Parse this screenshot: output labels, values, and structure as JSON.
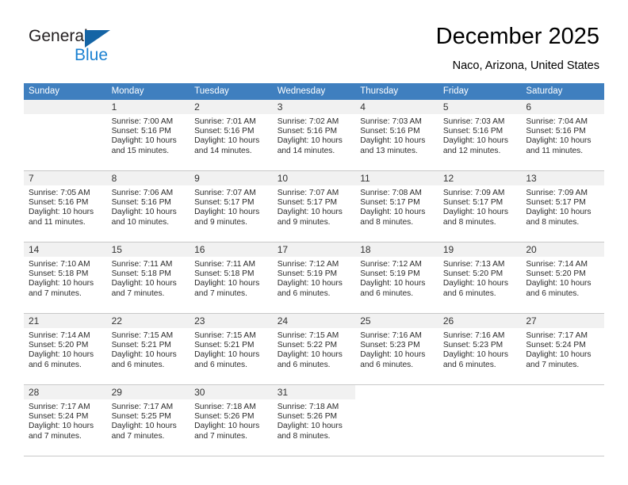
{
  "brand": {
    "name_part1": "General",
    "name_part2": "Blue",
    "triangle_color": "#1464a5",
    "blue_text_color": "#1b81d1"
  },
  "header": {
    "title": "December 2025",
    "subtitle": "Naco, Arizona, United States"
  },
  "theme": {
    "header_row_bg": "#3f7fbf",
    "header_row_text": "#ffffff",
    "daynumber_bg": "#f1f1f1",
    "grid_line": "#c8c8c8"
  },
  "weekdays": [
    "Sunday",
    "Monday",
    "Tuesday",
    "Wednesday",
    "Thursday",
    "Friday",
    "Saturday"
  ],
  "weeks": [
    [
      {
        "day": "",
        "sunrise": "",
        "sunset": "",
        "daylight_line1": "",
        "daylight_line2": ""
      },
      {
        "day": "1",
        "sunrise": "Sunrise: 7:00 AM",
        "sunset": "Sunset: 5:16 PM",
        "daylight_line1": "Daylight: 10 hours",
        "daylight_line2": "and 15 minutes."
      },
      {
        "day": "2",
        "sunrise": "Sunrise: 7:01 AM",
        "sunset": "Sunset: 5:16 PM",
        "daylight_line1": "Daylight: 10 hours",
        "daylight_line2": "and 14 minutes."
      },
      {
        "day": "3",
        "sunrise": "Sunrise: 7:02 AM",
        "sunset": "Sunset: 5:16 PM",
        "daylight_line1": "Daylight: 10 hours",
        "daylight_line2": "and 14 minutes."
      },
      {
        "day": "4",
        "sunrise": "Sunrise: 7:03 AM",
        "sunset": "Sunset: 5:16 PM",
        "daylight_line1": "Daylight: 10 hours",
        "daylight_line2": "and 13 minutes."
      },
      {
        "day": "5",
        "sunrise": "Sunrise: 7:03 AM",
        "sunset": "Sunset: 5:16 PM",
        "daylight_line1": "Daylight: 10 hours",
        "daylight_line2": "and 12 minutes."
      },
      {
        "day": "6",
        "sunrise": "Sunrise: 7:04 AM",
        "sunset": "Sunset: 5:16 PM",
        "daylight_line1": "Daylight: 10 hours",
        "daylight_line2": "and 11 minutes."
      }
    ],
    [
      {
        "day": "7",
        "sunrise": "Sunrise: 7:05 AM",
        "sunset": "Sunset: 5:16 PM",
        "daylight_line1": "Daylight: 10 hours",
        "daylight_line2": "and 11 minutes."
      },
      {
        "day": "8",
        "sunrise": "Sunrise: 7:06 AM",
        "sunset": "Sunset: 5:16 PM",
        "daylight_line1": "Daylight: 10 hours",
        "daylight_line2": "and 10 minutes."
      },
      {
        "day": "9",
        "sunrise": "Sunrise: 7:07 AM",
        "sunset": "Sunset: 5:17 PM",
        "daylight_line1": "Daylight: 10 hours",
        "daylight_line2": "and 9 minutes."
      },
      {
        "day": "10",
        "sunrise": "Sunrise: 7:07 AM",
        "sunset": "Sunset: 5:17 PM",
        "daylight_line1": "Daylight: 10 hours",
        "daylight_line2": "and 9 minutes."
      },
      {
        "day": "11",
        "sunrise": "Sunrise: 7:08 AM",
        "sunset": "Sunset: 5:17 PM",
        "daylight_line1": "Daylight: 10 hours",
        "daylight_line2": "and 8 minutes."
      },
      {
        "day": "12",
        "sunrise": "Sunrise: 7:09 AM",
        "sunset": "Sunset: 5:17 PM",
        "daylight_line1": "Daylight: 10 hours",
        "daylight_line2": "and 8 minutes."
      },
      {
        "day": "13",
        "sunrise": "Sunrise: 7:09 AM",
        "sunset": "Sunset: 5:17 PM",
        "daylight_line1": "Daylight: 10 hours",
        "daylight_line2": "and 8 minutes."
      }
    ],
    [
      {
        "day": "14",
        "sunrise": "Sunrise: 7:10 AM",
        "sunset": "Sunset: 5:18 PM",
        "daylight_line1": "Daylight: 10 hours",
        "daylight_line2": "and 7 minutes."
      },
      {
        "day": "15",
        "sunrise": "Sunrise: 7:11 AM",
        "sunset": "Sunset: 5:18 PM",
        "daylight_line1": "Daylight: 10 hours",
        "daylight_line2": "and 7 minutes."
      },
      {
        "day": "16",
        "sunrise": "Sunrise: 7:11 AM",
        "sunset": "Sunset: 5:18 PM",
        "daylight_line1": "Daylight: 10 hours",
        "daylight_line2": "and 7 minutes."
      },
      {
        "day": "17",
        "sunrise": "Sunrise: 7:12 AM",
        "sunset": "Sunset: 5:19 PM",
        "daylight_line1": "Daylight: 10 hours",
        "daylight_line2": "and 6 minutes."
      },
      {
        "day": "18",
        "sunrise": "Sunrise: 7:12 AM",
        "sunset": "Sunset: 5:19 PM",
        "daylight_line1": "Daylight: 10 hours",
        "daylight_line2": "and 6 minutes."
      },
      {
        "day": "19",
        "sunrise": "Sunrise: 7:13 AM",
        "sunset": "Sunset: 5:20 PM",
        "daylight_line1": "Daylight: 10 hours",
        "daylight_line2": "and 6 minutes."
      },
      {
        "day": "20",
        "sunrise": "Sunrise: 7:14 AM",
        "sunset": "Sunset: 5:20 PM",
        "daylight_line1": "Daylight: 10 hours",
        "daylight_line2": "and 6 minutes."
      }
    ],
    [
      {
        "day": "21",
        "sunrise": "Sunrise: 7:14 AM",
        "sunset": "Sunset: 5:20 PM",
        "daylight_line1": "Daylight: 10 hours",
        "daylight_line2": "and 6 minutes."
      },
      {
        "day": "22",
        "sunrise": "Sunrise: 7:15 AM",
        "sunset": "Sunset: 5:21 PM",
        "daylight_line1": "Daylight: 10 hours",
        "daylight_line2": "and 6 minutes."
      },
      {
        "day": "23",
        "sunrise": "Sunrise: 7:15 AM",
        "sunset": "Sunset: 5:21 PM",
        "daylight_line1": "Daylight: 10 hours",
        "daylight_line2": "and 6 minutes."
      },
      {
        "day": "24",
        "sunrise": "Sunrise: 7:15 AM",
        "sunset": "Sunset: 5:22 PM",
        "daylight_line1": "Daylight: 10 hours",
        "daylight_line2": "and 6 minutes."
      },
      {
        "day": "25",
        "sunrise": "Sunrise: 7:16 AM",
        "sunset": "Sunset: 5:23 PM",
        "daylight_line1": "Daylight: 10 hours",
        "daylight_line2": "and 6 minutes."
      },
      {
        "day": "26",
        "sunrise": "Sunrise: 7:16 AM",
        "sunset": "Sunset: 5:23 PM",
        "daylight_line1": "Daylight: 10 hours",
        "daylight_line2": "and 6 minutes."
      },
      {
        "day": "27",
        "sunrise": "Sunrise: 7:17 AM",
        "sunset": "Sunset: 5:24 PM",
        "daylight_line1": "Daylight: 10 hours",
        "daylight_line2": "and 7 minutes."
      }
    ],
    [
      {
        "day": "28",
        "sunrise": "Sunrise: 7:17 AM",
        "sunset": "Sunset: 5:24 PM",
        "daylight_line1": "Daylight: 10 hours",
        "daylight_line2": "and 7 minutes."
      },
      {
        "day": "29",
        "sunrise": "Sunrise: 7:17 AM",
        "sunset": "Sunset: 5:25 PM",
        "daylight_line1": "Daylight: 10 hours",
        "daylight_line2": "and 7 minutes."
      },
      {
        "day": "30",
        "sunrise": "Sunrise: 7:18 AM",
        "sunset": "Sunset: 5:26 PM",
        "daylight_line1": "Daylight: 10 hours",
        "daylight_line2": "and 7 minutes."
      },
      {
        "day": "31",
        "sunrise": "Sunrise: 7:18 AM",
        "sunset": "Sunset: 5:26 PM",
        "daylight_line1": "Daylight: 10 hours",
        "daylight_line2": "and 8 minutes."
      },
      {
        "day": "",
        "sunrise": "",
        "sunset": "",
        "daylight_line1": "",
        "daylight_line2": ""
      },
      {
        "day": "",
        "sunrise": "",
        "sunset": "",
        "daylight_line1": "",
        "daylight_line2": ""
      },
      {
        "day": "",
        "sunrise": "",
        "sunset": "",
        "daylight_line1": "",
        "daylight_line2": ""
      }
    ]
  ]
}
